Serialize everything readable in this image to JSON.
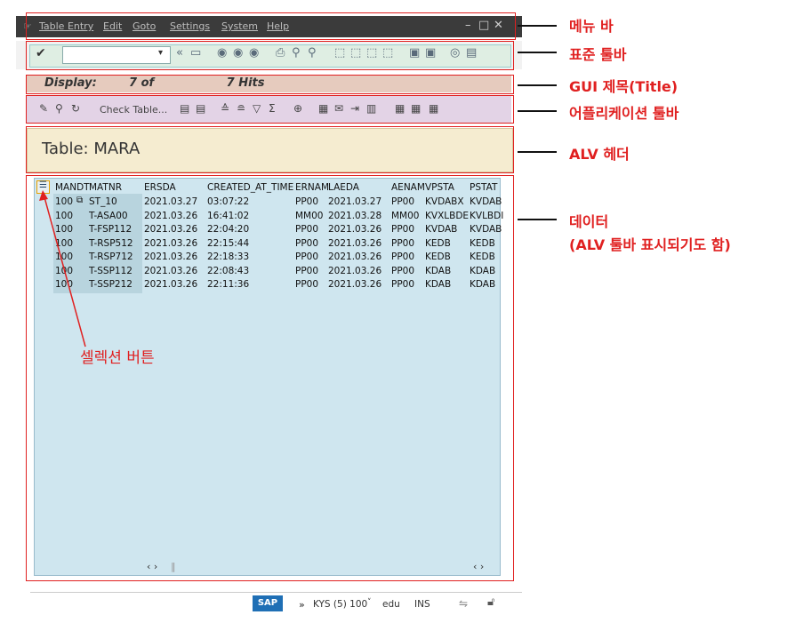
{
  "menu": {
    "items": [
      "Table Entry",
      "Edit",
      "Goto",
      "Settings",
      "System",
      "Help"
    ]
  },
  "title": {
    "text": "Display:        7 of                  7 Hits"
  },
  "apptoolbar": {
    "check_table": "Check Table..."
  },
  "alv": {
    "header": "Table: MARA"
  },
  "table": {
    "columns": [
      "MANDT",
      "MATNR",
      "ERSDA",
      "CREATED_AT_TIME",
      "ERNAM",
      "LAEDA",
      "AENAM",
      "VPSTA",
      "PSTAT"
    ],
    "rows": [
      [
        "100",
        "ST_10",
        "2021.03.27",
        "03:07:22",
        "PP00",
        "2021.03.27",
        "PP00",
        "KVDABX",
        "KVDAB"
      ],
      [
        "100",
        "T-ASA00",
        "2021.03.26",
        "16:41:02",
        "MM00",
        "2021.03.28",
        "MM00",
        "KVXLBDE",
        "KVLBDI"
      ],
      [
        "100",
        "T-FSP112",
        "2021.03.26",
        "22:04:20",
        "PP00",
        "2021.03.26",
        "PP00",
        "KVDAB",
        "KVDAB"
      ],
      [
        "100",
        "T-RSP512",
        "2021.03.26",
        "22:15:44",
        "PP00",
        "2021.03.26",
        "PP00",
        "KEDB",
        "KEDB"
      ],
      [
        "100",
        "T-RSP712",
        "2021.03.26",
        "22:18:33",
        "PP00",
        "2021.03.26",
        "PP00",
        "KEDB",
        "KEDB"
      ],
      [
        "100",
        "T-SSP112",
        "2021.03.26",
        "22:08:43",
        "PP00",
        "2021.03.26",
        "PP00",
        "KDAB",
        "KDAB"
      ],
      [
        "100",
        "T-SSP212",
        "2021.03.26",
        "22:11:36",
        "PP00",
        "2021.03.26",
        "PP00",
        "KDAB",
        "KDAB"
      ]
    ]
  },
  "status": {
    "logo": "SAP",
    "session": "KYS (5) 100",
    "server": "edu",
    "mode": "INS"
  },
  "annotations": {
    "menu_bar": "메뉴 바",
    "standard_toolbar": "표준 툴바",
    "gui_title": "GUI 제목(Title)",
    "app_toolbar": "어플리케이션 툴바",
    "alv_header": "ALV 헤더",
    "data_line1": "데이터",
    "data_line2": "(ALV 툴바 표시되기도 함)",
    "select_button": "셀렉션 버튼"
  },
  "colors": {
    "annotation": "#e02020"
  }
}
